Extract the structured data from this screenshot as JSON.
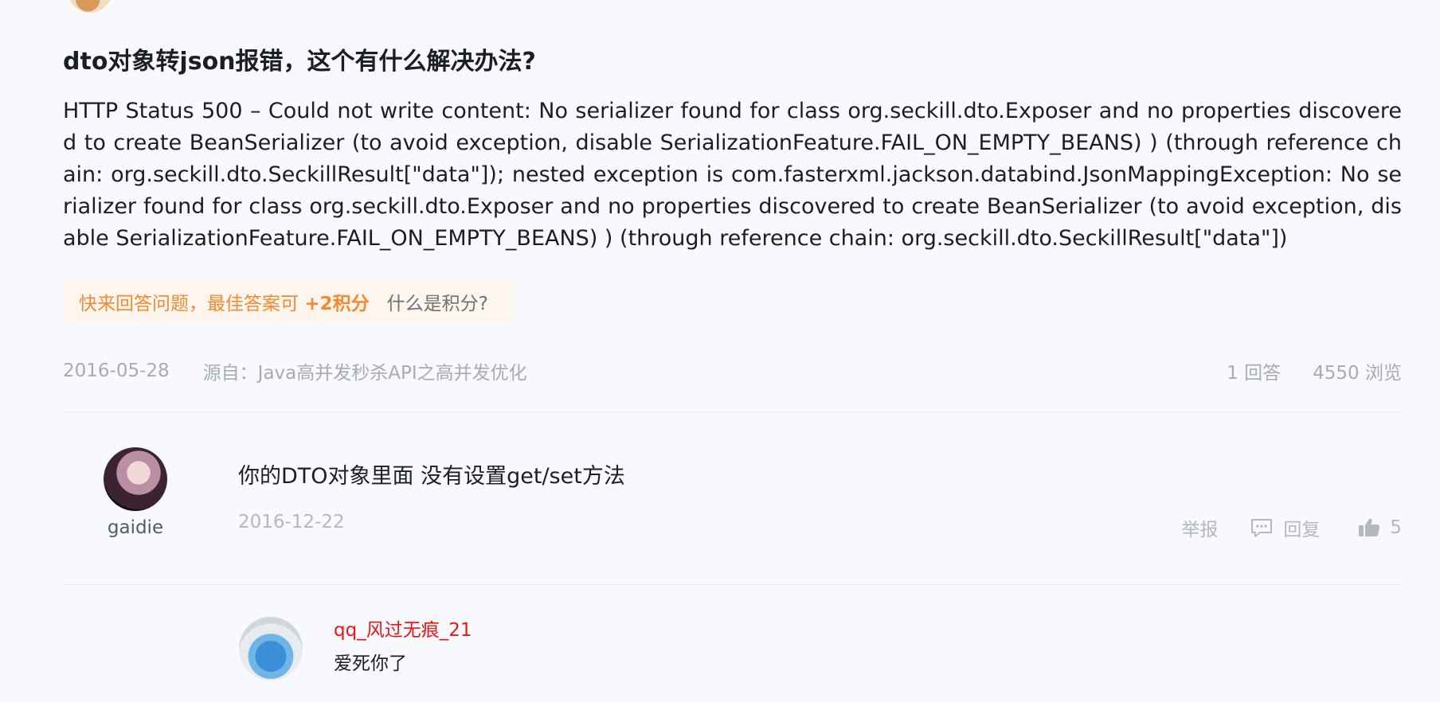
{
  "question": {
    "title": "dto对象转json报错，这个有什么解决办法?",
    "body": "HTTP Status 500 – Could not write content: No serializer found for class org.seckill.dto.Exposer and no properties discovered to create BeanSerializer (to avoid exception, disable SerializationFeature.FAIL_ON_EMPTY_BEANS) ) (through reference chain: org.seckill.dto.SeckillResult[\"data\"]); nested exception is com.fasterxml.jackson.databind.JsonMappingException: No serializer found for class org.seckill.dto.Exposer and no properties discovered to create BeanSerializer (to avoid exception, disable SerializationFeature.FAIL_ON_EMPTY_BEANS) ) (through reference chain: org.seckill.dto.SeckillResult[\"data\"])",
    "points_prompt": "快来回答问题，最佳答案可",
    "points_value": "+2积分",
    "points_help_link": "什么是积分?",
    "date": "2016-05-28",
    "source": "源自：Java高并发秒杀API之高并发优化",
    "answer_count": "1 回答",
    "view_count": "4550 浏览"
  },
  "answer": {
    "username": "gaidie",
    "content": "你的DTO对象里面 没有设置get/set方法",
    "date": "2016-12-22",
    "report_label": "举报",
    "reply_label": "回复",
    "like_count": "5"
  },
  "reply": {
    "username": "qq_风过无痕_21",
    "content": "爱死你了"
  },
  "colors": {
    "accent_orange": "#f28a33",
    "reply_username_red": "#f01414",
    "muted_text": "#a7acb2"
  },
  "icons": {
    "reply": "speech-bubble-icon",
    "like": "thumbs-up-icon"
  }
}
